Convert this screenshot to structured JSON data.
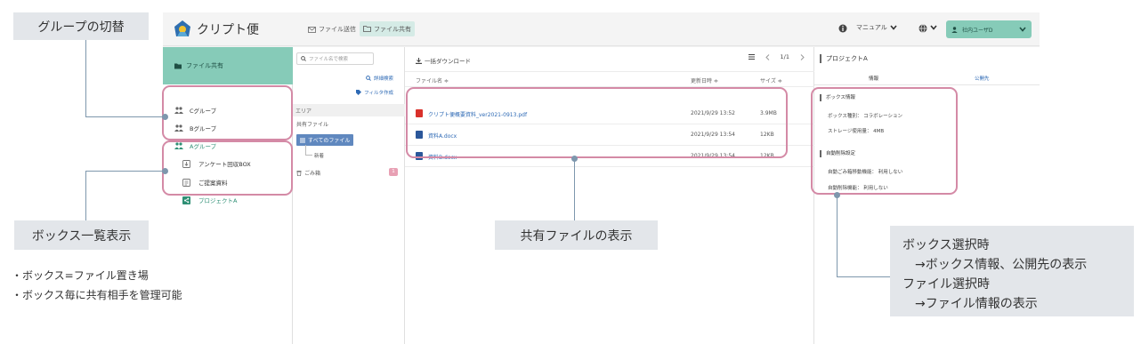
{
  "app": {
    "logo_text": "クリプト便",
    "nav": {
      "send_label": "ファイル送信",
      "share_label": "ファイル共有"
    },
    "manual_label": "マニュアル",
    "user_label": "社内ユーザD"
  },
  "sidebar": {
    "header_label": "ファイル共有",
    "groups": [
      {
        "label": "Cグループ"
      },
      {
        "label": "Bグループ"
      },
      {
        "label": "Aグループ"
      }
    ],
    "boxes": [
      {
        "label": "アンケート回収BOX"
      },
      {
        "label": "ご提案資料"
      },
      {
        "label": "プロジェクトA"
      }
    ]
  },
  "folder_panel": {
    "search_placeholder": "ファイル名で検索",
    "detail_search": "詳細検索",
    "filter_create": "フィルタ作成",
    "area_header": "エリア",
    "share_files": "共有ファイル",
    "all_files": "すべてのファイル",
    "new_folder": "新着",
    "trash": "ごみ箱",
    "trash_count": "1"
  },
  "file_list": {
    "bulk_download": "一括ダウンロード",
    "page": "1/1",
    "columns": {
      "name": "ファイル名 ≑",
      "date": "更新日時 ≑",
      "size": "サイズ ≑"
    },
    "rows": [
      {
        "name": "クリプト便概要資料_ver2021-0913.pdf",
        "date": "2021/9/29 13:52",
        "size": "3.9MB",
        "type": "pdf"
      },
      {
        "name": "資料A.docx",
        "date": "2021/9/29 13:54",
        "size": "12KB",
        "type": "docx"
      },
      {
        "name": "資料B.docx",
        "date": "2021/9/29 13:54",
        "size": "12KB",
        "type": "docx"
      }
    ]
  },
  "info_panel": {
    "title": "プロジェクトA",
    "tab_info": "情報",
    "tab_public": "公開先",
    "box_info_title": "ボックス情報",
    "box_type": "ボックス種別： コラボレーション",
    "storage": "ストレージ使用量： 4MB",
    "auto_delete_title": "自動削除設定",
    "auto_trash": "自動ごみ箱移動機能： 利用しない",
    "auto_delete": "自動削除機能： 利用しない"
  },
  "annotations": {
    "group_switch": "グループの切替",
    "box_list": "ボックス一覧表示",
    "shared_files": "共有ファイルの表示",
    "select_line1": "ボックス選択時",
    "select_line2": "→ボックス情報、公開先の表示",
    "select_line3": "ファイル選択時",
    "select_line4": "→ファイル情報の表示",
    "note1": "・ボックス=ファイル置き場",
    "note2": "・ボックス毎に共有相手を管理可能"
  },
  "colors": {
    "accent_green": "#86cbb8",
    "highlight_pink": "#d48aa6",
    "connector": "#7e97ad",
    "link_blue": "#2e6ab5",
    "pdf_red": "#d9312b",
    "docx_blue": "#2b579a"
  }
}
